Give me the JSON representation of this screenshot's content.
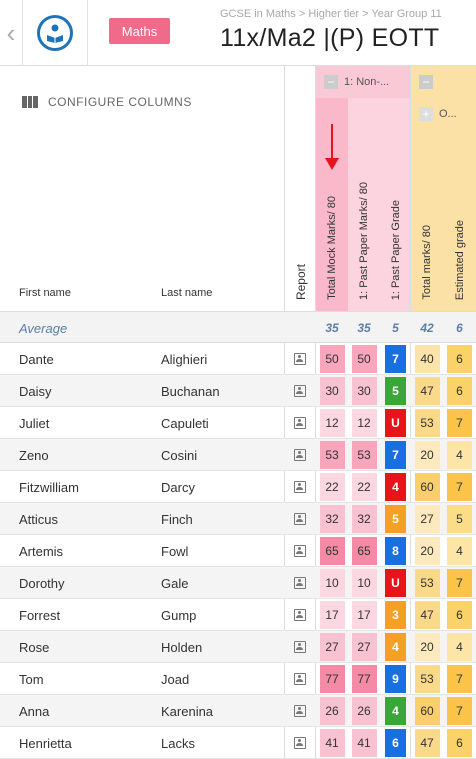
{
  "header": {
    "subject": "Maths",
    "breadcrumb": "GCSE in Maths > Higher tier > Year Group 11",
    "title": "11x/Ma2 |(P) EOTT"
  },
  "toolbar": {
    "configure_label": "CONFIGURE COLUMNS"
  },
  "groups": {
    "group1_label": "1: Non-...",
    "group2_label": "",
    "sub_group_label": "O..."
  },
  "columns": {
    "first_name": "First name",
    "last_name": "Last name",
    "report": "Report",
    "total_mock": "Total Mock Marks/ 80",
    "past_paper_marks": "1: Past Paper Marks/ 80",
    "past_paper_grade": "1: Past Paper Grade",
    "total_marks": "Total marks/ 80",
    "estimated_grade": "Estimated grade"
  },
  "average": {
    "label": "Average",
    "total_mock": "35",
    "past_paper_marks": "35",
    "past_paper_grade": "5",
    "total_marks": "42",
    "estimated_grade": "6"
  },
  "students": [
    {
      "first": "Dante",
      "last": "Alighieri",
      "total_mock": "50",
      "ppm": "50",
      "grade": "7",
      "total": "40",
      "est": "6"
    },
    {
      "first": "Daisy",
      "last": "Buchanan",
      "total_mock": "30",
      "ppm": "30",
      "grade": "5",
      "total": "47",
      "est": "6"
    },
    {
      "first": "Juliet",
      "last": "Capuleti",
      "total_mock": "12",
      "ppm": "12",
      "grade": "U",
      "total": "53",
      "est": "7"
    },
    {
      "first": "Zeno",
      "last": "Cosini",
      "total_mock": "53",
      "ppm": "53",
      "grade": "7",
      "total": "20",
      "est": "4"
    },
    {
      "first": "Fitzwilliam",
      "last": "Darcy",
      "total_mock": "22",
      "ppm": "22",
      "grade": "4",
      "total": "60",
      "est": "7"
    },
    {
      "first": "Atticus",
      "last": "Finch",
      "total_mock": "32",
      "ppm": "32",
      "grade": "5",
      "total": "27",
      "est": "5"
    },
    {
      "first": "Artemis",
      "last": "Fowl",
      "total_mock": "65",
      "ppm": "65",
      "grade": "8",
      "total": "20",
      "est": "4"
    },
    {
      "first": "Dorothy",
      "last": "Gale",
      "total_mock": "10",
      "ppm": "10",
      "grade": "U",
      "total": "53",
      "est": "7"
    },
    {
      "first": "Forrest",
      "last": "Gump",
      "total_mock": "17",
      "ppm": "17",
      "grade": "3",
      "total": "47",
      "est": "6"
    },
    {
      "first": "Rose",
      "last": "Holden",
      "total_mock": "27",
      "ppm": "27",
      "grade": "4",
      "total": "20",
      "est": "4"
    },
    {
      "first": "Tom",
      "last": "Joad",
      "total_mock": "77",
      "ppm": "77",
      "grade": "9",
      "total": "53",
      "est": "7"
    },
    {
      "first": "Anna",
      "last": "Karenina",
      "total_mock": "26",
      "ppm": "26",
      "grade": "4",
      "total": "60",
      "est": "7"
    },
    {
      "first": "Henrietta",
      "last": "Lacks",
      "total_mock": "41",
      "ppm": "41",
      "grade": "6",
      "total": "47",
      "est": "6"
    }
  ],
  "colors": {
    "subject_badge": "#f06b8a",
    "group1_header": "#f9c9d6",
    "group2_header": "#fbe1a6",
    "grade_U": "#e8141c",
    "grade_3": "#f4a024",
    "grade_4": "#e8141c",
    "grade_5": "#f4a024",
    "grade_6": "#1a6fe0",
    "grade_7": "#1a6fe0",
    "grade_8": "#1a6fe0",
    "grade_9": "#1a6fe0"
  }
}
